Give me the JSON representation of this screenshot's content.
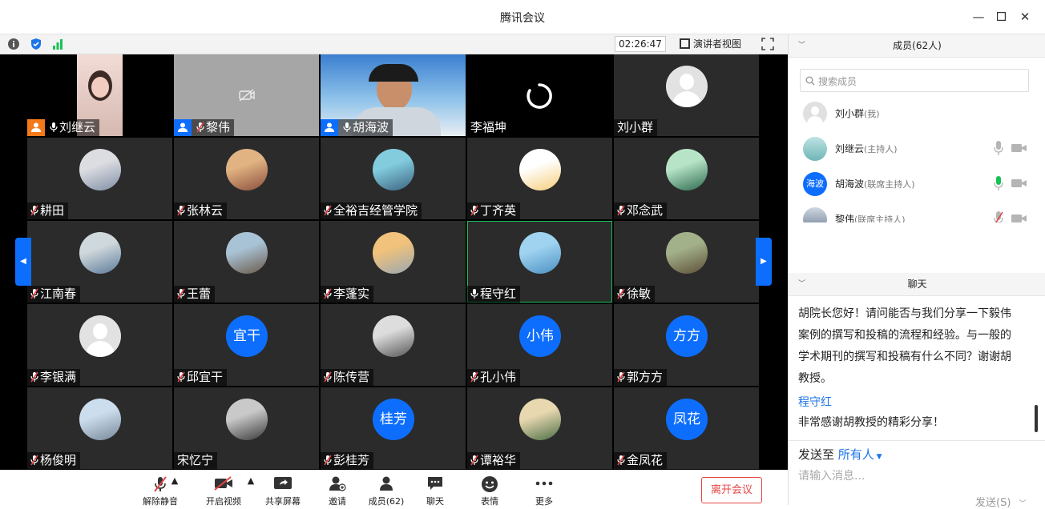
{
  "window": {
    "title": "腾讯会议"
  },
  "topbar": {
    "timer": "02:26:47",
    "speaker_view": "演讲者视图"
  },
  "tiles": [
    {
      "name": "刘继云",
      "mic": "on",
      "host": "orange",
      "kind": "video"
    },
    {
      "name": "黎伟",
      "mic": "off",
      "host": "blue",
      "kind": "camoff"
    },
    {
      "name": "胡海波",
      "mic": "on",
      "host": "blue",
      "kind": "video"
    },
    {
      "name": "李福坤",
      "mic": "none",
      "host": "",
      "kind": "loading"
    },
    {
      "name": "刘小群",
      "mic": "none",
      "host": "",
      "kind": "blank"
    },
    {
      "name": "耕田",
      "mic": "off",
      "kind": "photo"
    },
    {
      "name": "张林云",
      "mic": "off",
      "kind": "photo"
    },
    {
      "name": "全裕吉经管学院",
      "mic": "off",
      "kind": "photo"
    },
    {
      "name": "丁齐英",
      "mic": "off",
      "kind": "photo"
    },
    {
      "name": "邓念武",
      "mic": "off",
      "kind": "photo"
    },
    {
      "name": "江南春",
      "mic": "off",
      "kind": "photo"
    },
    {
      "name": "王蕾",
      "mic": "off",
      "kind": "photo"
    },
    {
      "name": "李蓬实",
      "mic": "off",
      "kind": "photo"
    },
    {
      "name": "程守红",
      "mic": "on",
      "kind": "photo",
      "active": true
    },
    {
      "name": "徐敏",
      "mic": "off",
      "kind": "photo"
    },
    {
      "name": "李银满",
      "mic": "off",
      "kind": "blank"
    },
    {
      "name": "邱宜干",
      "mic": "off",
      "kind": "text",
      "avatar_text": "宜干"
    },
    {
      "name": "陈传营",
      "mic": "off",
      "kind": "photo"
    },
    {
      "name": "孔小伟",
      "mic": "off",
      "kind": "text",
      "avatar_text": "小伟"
    },
    {
      "name": "郭方方",
      "mic": "off",
      "kind": "text",
      "avatar_text": "方方"
    },
    {
      "name": "杨俊明",
      "mic": "off",
      "kind": "photo"
    },
    {
      "name": "宋忆宁",
      "mic": "none",
      "kind": "photo"
    },
    {
      "name": "彭桂芳",
      "mic": "off",
      "kind": "text",
      "avatar_text": "桂芳"
    },
    {
      "name": "谭裕华",
      "mic": "off",
      "kind": "photo"
    },
    {
      "name": "金凤花",
      "mic": "off",
      "kind": "text",
      "avatar_text": "凤花"
    }
  ],
  "toolbar": {
    "unmute": "解除静音",
    "start_video": "开启视频",
    "share_screen": "共享屏幕",
    "invite": "邀请",
    "members": "成员(62)",
    "chat": "聊天",
    "reactions": "表情",
    "more": "更多",
    "leave": "离开会议"
  },
  "members_panel": {
    "title": "成员(62人)",
    "search_placeholder": "搜索成员",
    "members": [
      {
        "name": "刘小群",
        "role": "(我)",
        "avatar": "blank"
      },
      {
        "name": "刘继云",
        "role": "(主持人)",
        "avatar": "photo",
        "mic": "gray"
      },
      {
        "name": "胡海波",
        "role": "(联席主持人)",
        "avatar": "text",
        "avatar_text": "海波",
        "mic": "green"
      },
      {
        "name": "黎伟",
        "role": "(联席主持人)",
        "avatar": "photo",
        "mic": "muted"
      }
    ]
  },
  "chat_panel": {
    "title": "聊天",
    "messages": [
      {
        "text_lines": [
          "胡院长您好！请问能否与我们分享一下毅伟",
          "案例的撰写和投稿的流程和经验。与一般的",
          "学术期刊的撰写和投稿有什么不同？谢谢胡",
          "教授。"
        ]
      },
      {
        "sender": "程守红",
        "text": "非常感谢胡教授的精彩分享！"
      }
    ],
    "send_to_label": "发送至",
    "send_to_target": "所有人",
    "input_placeholder": "请输入消息...",
    "send_button": "发送(S)"
  },
  "colors": {
    "accent": "#0d6efd",
    "leave": "#e64545",
    "active_border": "#19c157",
    "sender": "#1d74e8"
  }
}
